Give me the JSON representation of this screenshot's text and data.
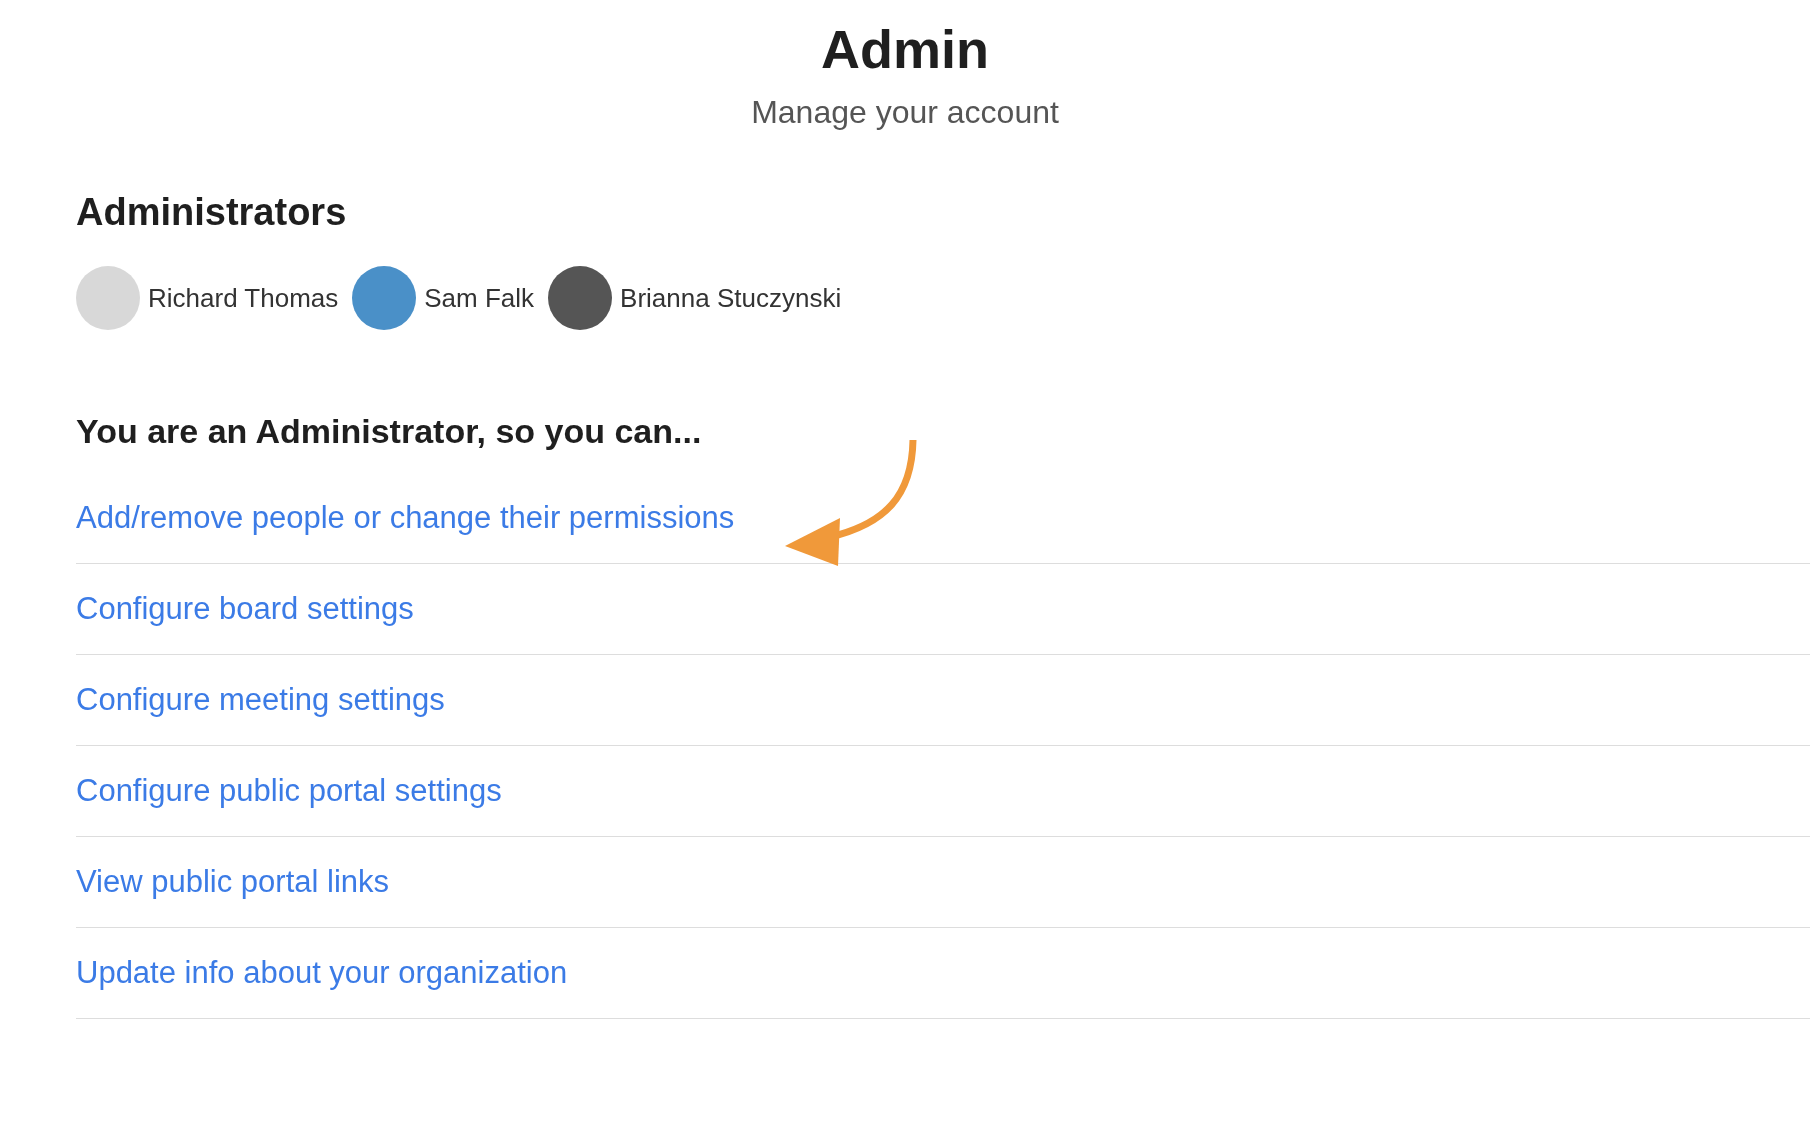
{
  "header": {
    "title": "Admin",
    "subtitle": "Manage your account"
  },
  "administrators": {
    "heading": "Administrators",
    "people": [
      {
        "name": "Richard Thomas"
      },
      {
        "name": "Sam Falk"
      },
      {
        "name": "Brianna Stuczynski"
      }
    ]
  },
  "permissions": {
    "heading": "You are an Administrator, so you can...",
    "links": [
      {
        "label": "Add/remove people or change their permissions"
      },
      {
        "label": "Configure board settings"
      },
      {
        "label": "Configure meeting settings"
      },
      {
        "label": "Configure public portal settings"
      },
      {
        "label": "View public portal links"
      },
      {
        "label": "Update info about your organization"
      }
    ]
  }
}
